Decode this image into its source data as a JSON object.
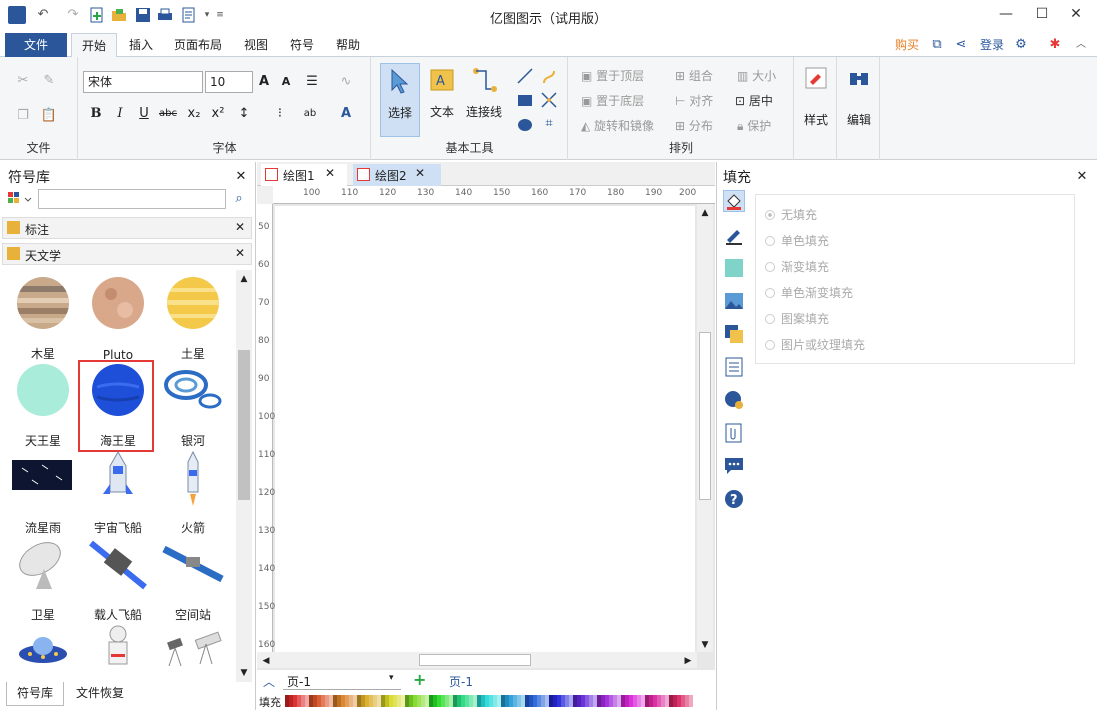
{
  "window": {
    "title": "亿图图示（试用版）"
  },
  "menu": {
    "tabs": [
      "文件",
      "开始",
      "插入",
      "页面布局",
      "视图",
      "符号",
      "帮助"
    ],
    "right": {
      "buy": "购买",
      "login": "登录"
    }
  },
  "ribbon": {
    "groups": {
      "file": "文件",
      "font": "字体",
      "basic_tools": "基本工具",
      "arrange": "排列"
    },
    "font_name": "宋体",
    "font_size": "10",
    "tools": {
      "select": "选择",
      "text": "文本",
      "connector": "连接线"
    },
    "arrange_items": [
      "置于顶层",
      "组合",
      "大小",
      "置于底层",
      "对齐",
      "居中",
      "旋转和镜像",
      "分布",
      "保护"
    ],
    "style": "样式",
    "edit": "编辑"
  },
  "left_panel": {
    "title": "符号库",
    "search_placeholder": "",
    "libraries": [
      "标注",
      "天文学"
    ],
    "symbols": [
      "木星",
      "Pluto",
      "土星",
      "天王星",
      "海王星",
      "银河",
      "流星雨",
      "宇宙飞船",
      "火箭",
      "卫星",
      "载人飞船",
      "空间站"
    ],
    "bottom_tabs": [
      "符号库",
      "文件恢复"
    ]
  },
  "docs": {
    "tabs": [
      "绘图1",
      "绘图2"
    ]
  },
  "ruler": {
    "h": [
      "100",
      "110",
      "120",
      "130",
      "140",
      "150",
      "160",
      "170",
      "180",
      "190",
      "200"
    ],
    "v": [
      "50",
      "60",
      "70",
      "80",
      "90",
      "100",
      "110",
      "120",
      "130",
      "140",
      "150",
      "160"
    ]
  },
  "page_bar": {
    "current": "页-1",
    "tab": "页-1",
    "fill_label": "填充"
  },
  "right_panel": {
    "title": "填充",
    "options": [
      "无填充",
      "单色填充",
      "渐变填充",
      "单色渐变填充",
      "图案填充",
      "图片或纹理填充"
    ]
  },
  "colors": {
    "accent": "#2b579a",
    "highlight": "#e53935",
    "canvas_bg": "#e7e7e7"
  }
}
